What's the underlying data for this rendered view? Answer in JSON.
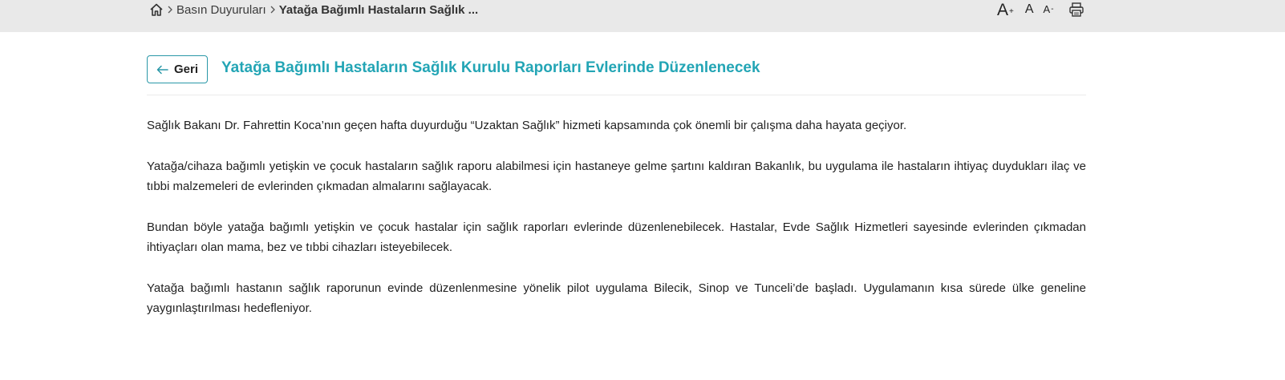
{
  "breadcrumb": {
    "home_icon": "home-icon",
    "items": [
      "Basın Duyuruları",
      "Yatağa Bağımlı Hastaların Sağlık ..."
    ]
  },
  "tools": {
    "increase": "A",
    "increase_mark": "+",
    "normal": "A",
    "decrease": "A",
    "decrease_mark": "-",
    "print_icon": "printer-icon"
  },
  "back_button": {
    "label": "Geri",
    "icon": "arrow-left-icon"
  },
  "article": {
    "title": "Yatağa Bağımlı Hastaların Sağlık Kurulu Raporları Evlerinde Düzenlenecek",
    "paragraphs": [
      "Sağlık Bakanı Dr. Fahrettin Koca’nın geçen hafta duyurduğu “Uzaktan Sağlık” hizmeti kapsamında çok önemli bir çalışma daha hayata geçiyor.",
      "Yatağa/cihaza bağımlı yetişkin ve çocuk hastaların sağlık raporu alabilmesi için hastaneye gelme şartını kaldıran Bakanlık, bu uygulama ile hastaların ihtiyaç duydukları ilaç ve tıbbi malzemeleri de evlerinden çıkmadan almalarını sağlayacak.",
      "Bundan böyle yatağa bağımlı yetişkin ve çocuk hastalar için sağlık raporları evlerinde düzenlenebilecek. Hastalar, Evde Sağlık Hizmetleri sayesinde evlerinden çıkmadan ihtiyaçları olan mama, bez ve tıbbi cihazları isteyebilecek.",
      "Yatağa bağımlı hastanın sağlık raporunun evinde düzenlenmesine yönelik pilot uygulama Bilecik, Sinop ve Tunceli’de başladı. Uygulamanın kısa sürede ülke geneline yaygınlaştırılması hedefleniyor."
    ]
  },
  "colors": {
    "accent": "#23a5b5",
    "topbar": "#e9e9e9"
  }
}
